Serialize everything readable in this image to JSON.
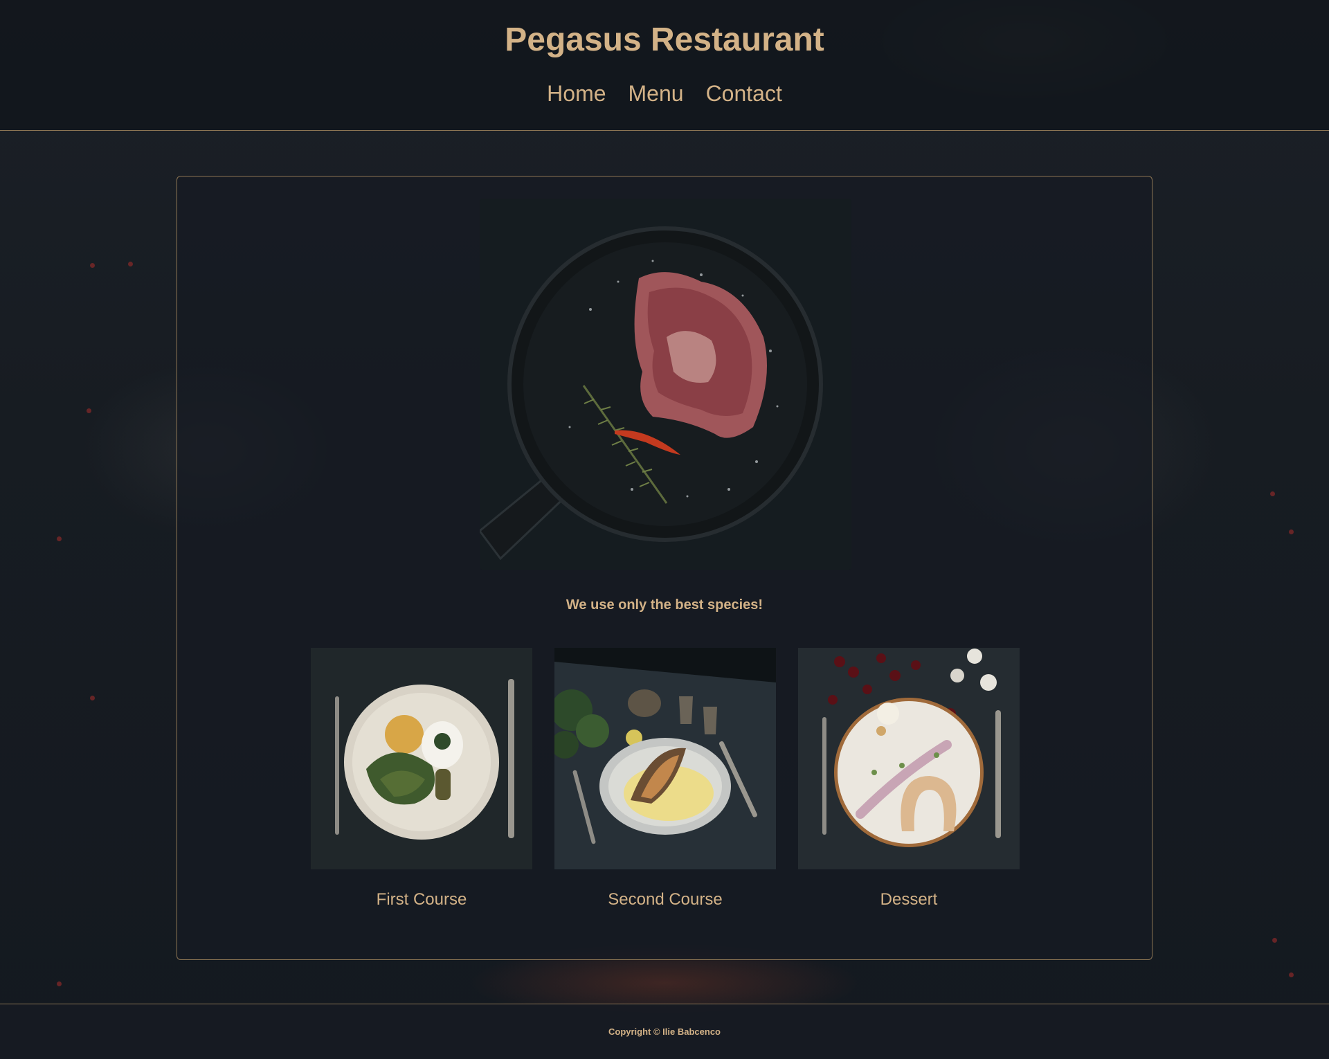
{
  "header": {
    "title": "Pegasus Restaurant",
    "nav": [
      "Home",
      "Menu",
      "Contact"
    ]
  },
  "main": {
    "hero_caption": "We use only the best species!",
    "courses": [
      "First Course",
      "Second Course",
      "Dessert"
    ]
  },
  "footer": {
    "copyright": "Copyright © Ilie Babcenco"
  },
  "colors": {
    "accent": "#d3b287",
    "border": "#8c7554",
    "background": "#161b22"
  }
}
